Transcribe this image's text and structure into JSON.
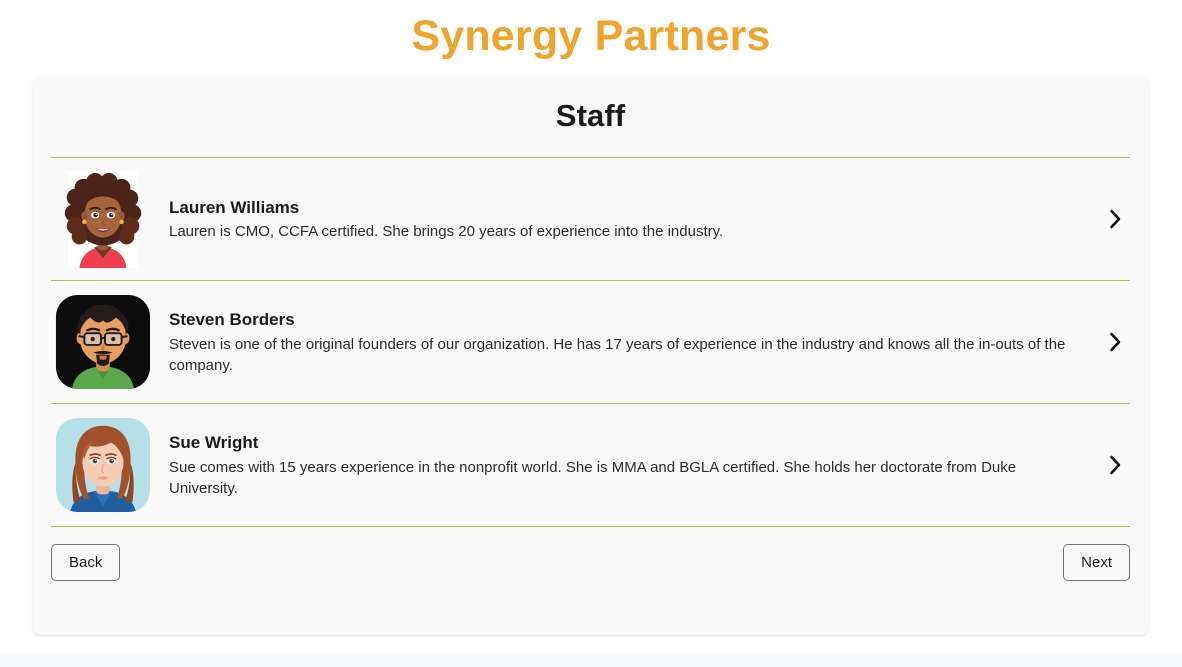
{
  "header": {
    "brand_title": "Synergy Partners",
    "brand_color": "#efa52c"
  },
  "card": {
    "title": "Staff",
    "divider_color": "#a7c44e"
  },
  "staff": [
    {
      "name": "Lauren Williams",
      "description": "Lauren is CMO, CCFA certified. She brings 20 years of experience into the industry.",
      "avatar_name": "avatar-lauren-williams",
      "chevron_icon": "chevron-right-icon"
    },
    {
      "name": "Steven Borders",
      "description": "Steven is one of the original founders of our organization. He has 17 years of experience in the industry and knows all the in-outs of the company.",
      "avatar_name": "avatar-steven-borders",
      "chevron_icon": "chevron-right-icon"
    },
    {
      "name": "Sue Wright",
      "description": "Sue comes with 15 years experience in the nonprofit world. She is MMA and BGLA certified. She holds her doctorate from Duke University.",
      "avatar_name": "avatar-sue-wright",
      "chevron_icon": "chevron-right-icon"
    }
  ],
  "footer": {
    "back_label": "Back",
    "next_label": "Next"
  }
}
